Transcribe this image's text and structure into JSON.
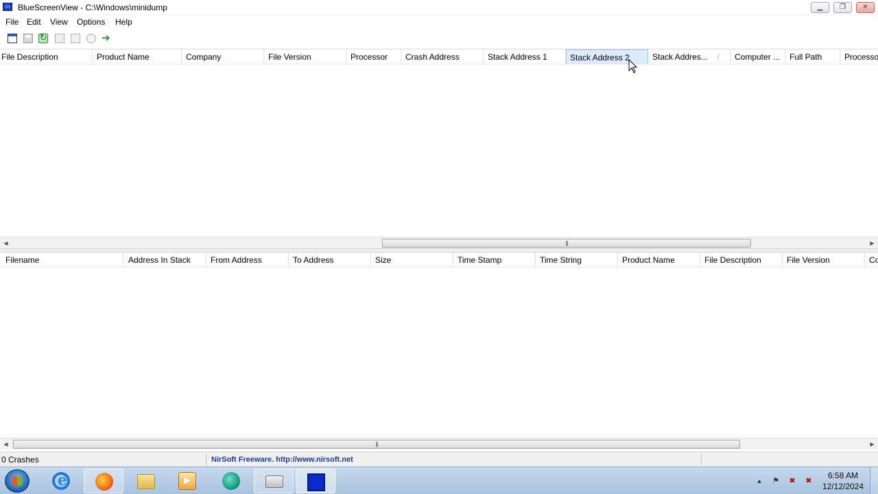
{
  "window": {
    "app_name": "BlueScreenView",
    "title": "BlueScreenView  -  C:\\Windows\\minidump",
    "controls": [
      "minimize",
      "restore",
      "close"
    ]
  },
  "menu": {
    "items": [
      "File",
      "Edit",
      "View",
      "Options",
      "Help"
    ]
  },
  "toolbar": {
    "icons": [
      "properties-icon",
      "save-icon",
      "refresh-icon",
      "copy-icon",
      "html-report-icon",
      "find-icon",
      "exit-icon"
    ]
  },
  "upper_list": {
    "columns": [
      "File Description",
      "Product Name",
      "Company",
      "File Version",
      "Processor",
      "Crash Address",
      "Stack Address 1",
      "Stack Address 2",
      "Stack Addres...",
      "Computer ...",
      "Full Path",
      "Processo"
    ],
    "hovered_column": "Stack Address 2",
    "rows": []
  },
  "lower_list": {
    "columns": [
      "Filename",
      "Address In Stack",
      "From Address",
      "To Address",
      "Size",
      "Time Stamp",
      "Time String",
      "Product Name",
      "File Description",
      "File Version",
      "Co"
    ],
    "rows": []
  },
  "statusbar": {
    "crash_count": "0 Crashes",
    "credit": "NirSoft Freeware.  http://www.nirsoft.net"
  },
  "taskbar": {
    "apps": [
      "Internet Explorer",
      "Firefox",
      "Windows Explorer",
      "Media Player",
      "Globe App",
      "Printer",
      "BlueScreenView"
    ],
    "active_app": "BlueScreenView",
    "clock_time": "6:58 AM",
    "clock_date": "12/12/2024"
  },
  "colors": {
    "header_hover": "#dcebfc",
    "nirsoft_link": "#1c3aa0",
    "taskbar": "#b7cde6"
  }
}
